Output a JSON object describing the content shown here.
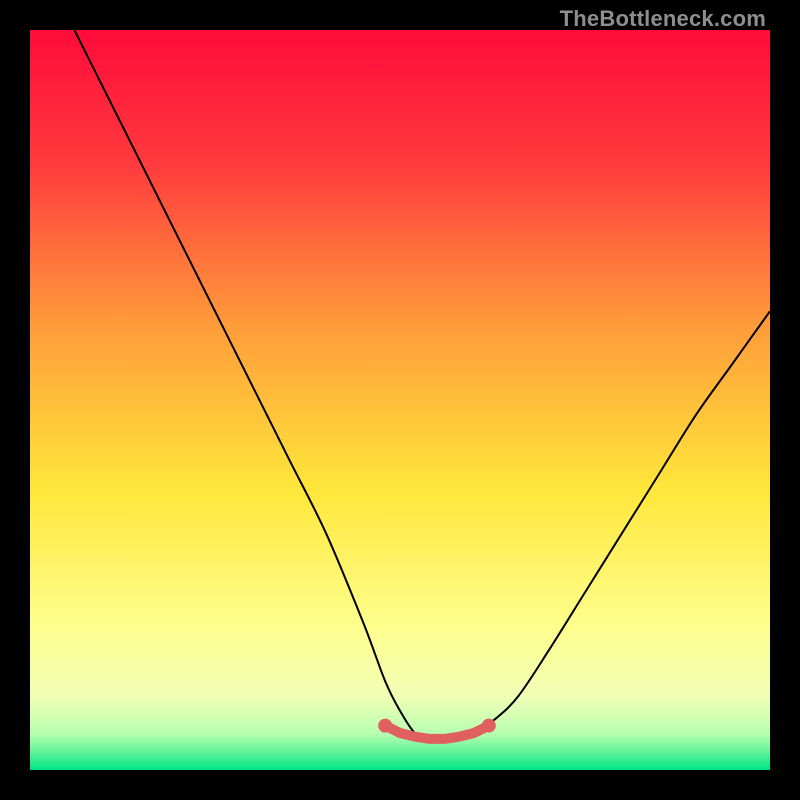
{
  "watermark": "TheBottleneck.com",
  "chart_data": {
    "type": "line",
    "title": "",
    "xlabel": "",
    "ylabel": "",
    "xlim": [
      0,
      100
    ],
    "ylim": [
      0,
      100
    ],
    "background_gradient": {
      "stops": [
        {
          "pos": 0.0,
          "color": "#ff0b3a"
        },
        {
          "pos": 0.18,
          "color": "#ff3a3d"
        },
        {
          "pos": 0.4,
          "color": "#ff9c3a"
        },
        {
          "pos": 0.62,
          "color": "#ffe63a"
        },
        {
          "pos": 0.8,
          "color": "#fefe8a"
        },
        {
          "pos": 0.9,
          "color": "#f1ffb6"
        },
        {
          "pos": 0.95,
          "color": "#b9ffb0"
        },
        {
          "pos": 0.975,
          "color": "#63f59a"
        },
        {
          "pos": 1.0,
          "color": "#00e487"
        }
      ]
    },
    "series": [
      {
        "name": "bottleneck-curve",
        "x": [
          6,
          10,
          15,
          20,
          25,
          30,
          35,
          40,
          45,
          48,
          50,
          52,
          54,
          56,
          58,
          60,
          63,
          66,
          70,
          75,
          80,
          85,
          90,
          95,
          100
        ],
        "y": [
          100,
          92,
          82,
          72,
          62,
          52,
          42,
          32,
          20,
          12,
          8,
          5,
          4,
          4,
          4,
          5,
          7,
          10,
          16,
          24,
          32,
          40,
          48,
          55,
          62
        ]
      }
    ],
    "highlight": {
      "name": "optimal-range",
      "x": [
        48,
        50,
        52,
        54,
        56,
        58,
        60,
        62
      ],
      "y": [
        6,
        5,
        4.5,
        4.2,
        4.2,
        4.5,
        5,
        6
      ],
      "color": "#e06060"
    }
  }
}
